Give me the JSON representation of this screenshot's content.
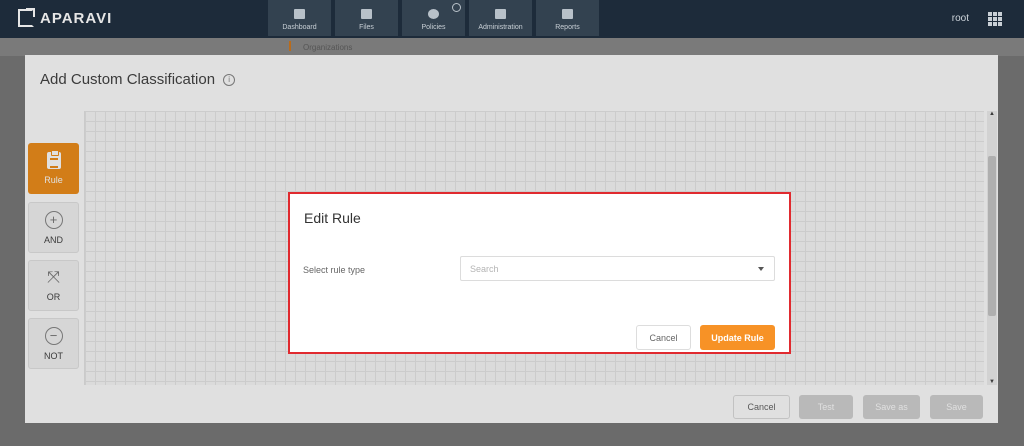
{
  "app": {
    "logo_text": "APARAVI",
    "user": "root"
  },
  "nav": [
    {
      "label": "Dashboard"
    },
    {
      "label": "Files"
    },
    {
      "label": "Policies"
    },
    {
      "label": "Administration"
    },
    {
      "label": "Reports"
    }
  ],
  "background": {
    "crumb": "Organizations"
  },
  "modal": {
    "title": "Add Custom Classification",
    "tools": [
      {
        "label": "Rule"
      },
      {
        "label": "AND"
      },
      {
        "label": "OR"
      },
      {
        "label": "NOT"
      }
    ],
    "footer": {
      "cancel": "Cancel",
      "test": "Test",
      "save_as": "Save as",
      "save": "Save"
    }
  },
  "dialog": {
    "title": "Edit Rule",
    "field_label": "Select rule type",
    "select_placeholder": "Search",
    "cancel_label": "Cancel",
    "update_label": "Update Rule"
  },
  "colors": {
    "topbar": "#1d2b3a",
    "accent": "#f79226",
    "highlight_border": "#e02a2f"
  }
}
